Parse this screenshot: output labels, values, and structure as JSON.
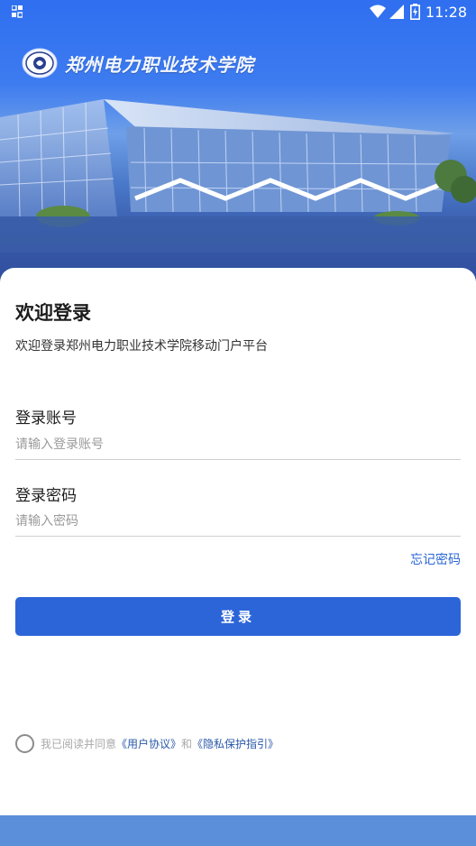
{
  "status_bar": {
    "time": "11:28"
  },
  "header": {
    "school_name": "郑州电力职业技术学院"
  },
  "login": {
    "title": "欢迎登录",
    "subtitle": "欢迎登录郑州电力职业技术学院移动门户平台",
    "account_label": "登录账号",
    "account_placeholder": "请输入登录账号",
    "account_value": "",
    "password_label": "登录密码",
    "password_placeholder": "请输入密码",
    "password_value": "",
    "forgot_label": "忘记密码",
    "submit_label": "登录"
  },
  "agreement": {
    "checked": false,
    "prefix": "我已阅读并同意",
    "user_agreement": "《用户协议》",
    "conjunction": "和",
    "privacy_policy": "《隐私保护指引》"
  },
  "colors": {
    "accent": "#2c65d8",
    "link": "#2a66d4",
    "header_blue": "#2f6ff0",
    "bottom_bar": "#5b8fd9"
  },
  "icons": [
    "app-notification-icon",
    "wifi-icon",
    "cellular-signal-icon",
    "battery-charging-icon",
    "school-emblem-icon",
    "radio-unchecked-icon"
  ]
}
